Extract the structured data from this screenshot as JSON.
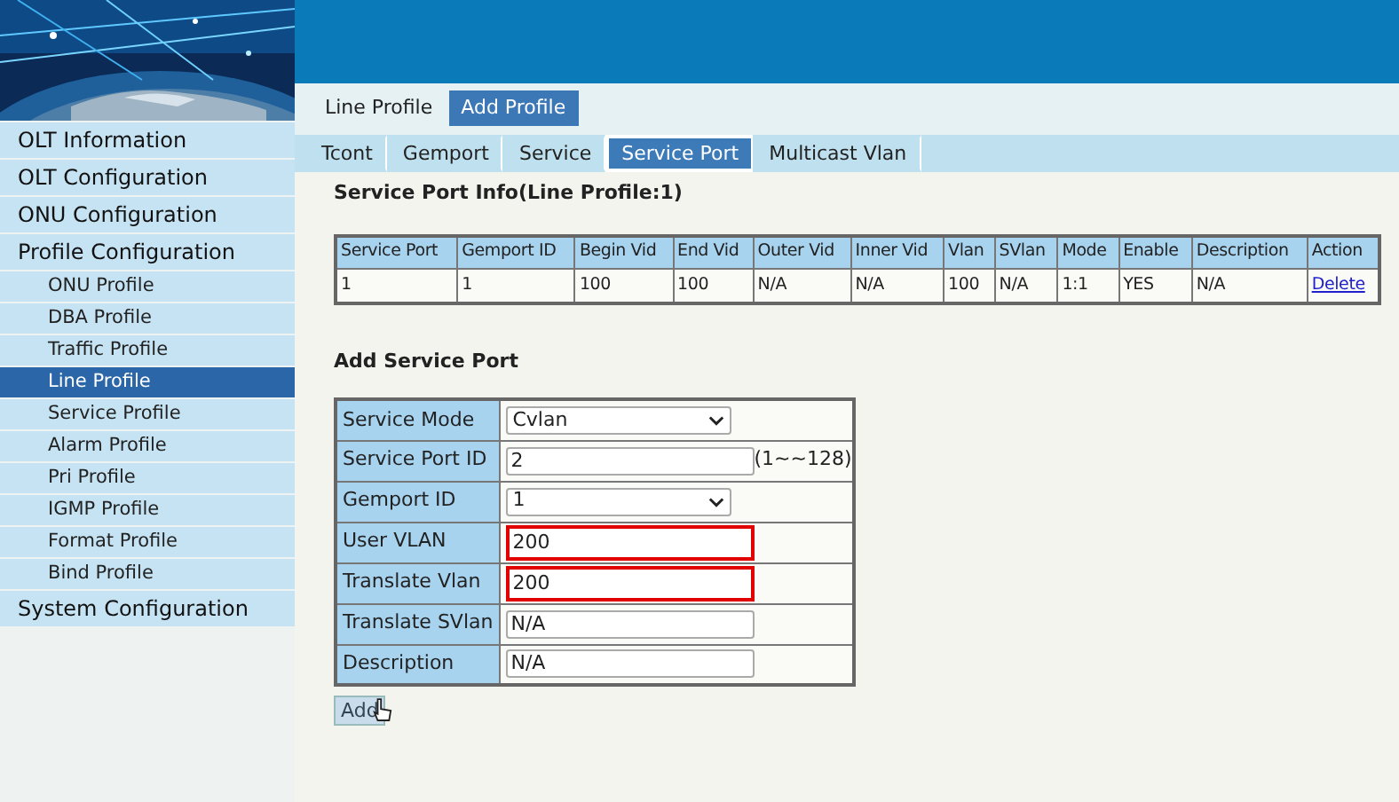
{
  "sidebar": {
    "items": [
      {
        "label": "OLT Information",
        "selected": false
      },
      {
        "label": "OLT Configuration",
        "selected": false
      },
      {
        "label": "ONU Configuration",
        "selected": false
      },
      {
        "label": "Profile Configuration",
        "selected": false,
        "children": [
          {
            "label": "ONU Profile",
            "selected": false
          },
          {
            "label": "DBA Profile",
            "selected": false
          },
          {
            "label": "Traffic Profile",
            "selected": false
          },
          {
            "label": "Line Profile",
            "selected": true
          },
          {
            "label": "Service Profile",
            "selected": false
          },
          {
            "label": "Alarm Profile",
            "selected": false
          },
          {
            "label": "Pri Profile",
            "selected": false
          },
          {
            "label": "IGMP Profile",
            "selected": false
          },
          {
            "label": "Format Profile",
            "selected": false
          },
          {
            "label": "Bind Profile",
            "selected": false
          }
        ]
      },
      {
        "label": "System Configuration",
        "selected": false
      }
    ]
  },
  "top_tabs": [
    {
      "label": "Line Profile",
      "selected": false
    },
    {
      "label": "Add Profile",
      "selected": true
    }
  ],
  "sub_tabs": [
    {
      "label": "Tcont",
      "selected": false,
      "highlighted": false
    },
    {
      "label": "Gemport",
      "selected": false,
      "highlighted": false
    },
    {
      "label": "Service",
      "selected": false,
      "highlighted": false
    },
    {
      "label": "Service Port",
      "selected": true,
      "highlighted": true
    },
    {
      "label": "Multicast Vlan",
      "selected": false,
      "highlighted": false
    }
  ],
  "info": {
    "title": "Service Port Info(Line Profile:1)",
    "columns": [
      "Service Port",
      "Gemport ID",
      "Begin Vid",
      "End Vid",
      "Outer Vid",
      "Inner Vid",
      "Vlan",
      "SVlan",
      "Mode",
      "Enable",
      "Description",
      "Action"
    ],
    "rows": [
      {
        "cells": [
          "1",
          "1",
          "100",
          "100",
          "N/A",
          "N/A",
          "100",
          "N/A",
          "1:1",
          "YES",
          "N/A"
        ],
        "action": "Delete"
      }
    ]
  },
  "form": {
    "title": "Add Service Port",
    "fields": [
      {
        "label": "Service Mode",
        "kind": "select",
        "value": "Cvlan",
        "highlighted": false
      },
      {
        "label": "Service Port ID",
        "kind": "text",
        "value": "2",
        "hint": "(1~~128)",
        "highlighted": false
      },
      {
        "label": "Gemport ID",
        "kind": "select",
        "value": "1",
        "highlighted": false
      },
      {
        "label": "User VLAN",
        "kind": "text",
        "value": "200",
        "highlighted": true
      },
      {
        "label": "Translate Vlan",
        "kind": "text",
        "value": "200",
        "highlighted": true
      },
      {
        "label": "Translate SVlan",
        "kind": "text",
        "value": "N/A",
        "highlighted": false
      },
      {
        "label": "Description",
        "kind": "text",
        "value": "N/A",
        "highlighted": false
      }
    ],
    "submit": "Add"
  }
}
